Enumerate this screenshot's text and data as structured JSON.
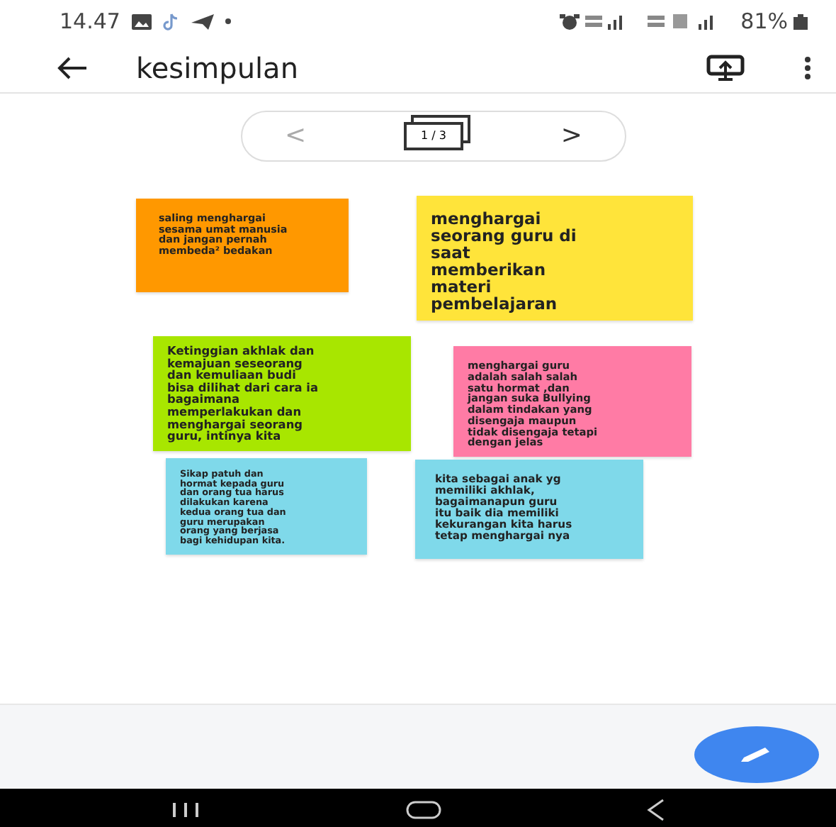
{
  "status_bar": {
    "time": "14.47",
    "battery": "81%"
  },
  "app_bar": {
    "title": "kesimpulan"
  },
  "pager": {
    "prev": "<",
    "page": "1 / 3",
    "next": ">"
  },
  "notes": [
    {
      "text": "saling menghargai\nsesama umat manusia\ndan jangan pernah\nmembeda² bedakan",
      "color": "#ff9800"
    },
    {
      "text": "menghargai\nseorang guru di\nsaat\nmemberikan\nmateri\npembelajaran",
      "color": "#ffe43a"
    },
    {
      "text": "Ketinggian akhlak dan\nkemajuan seseorang\ndan kemuliaan budi\nbisa dilihat dari cara ia\nbagaimana\nmemperlakukan dan\nmenghargai seorang\nguru, intinya kita",
      "color": "#a8e600"
    },
    {
      "text": "menghargai guru\nadalah salah salah\nsatu hormat ,dan\njangan suka Bullying\ndalam tindakan yang\ndisengaja maupun\ntidak disengaja tetapi\ndengan jelas",
      "color": "#ff7ba5"
    },
    {
      "text": "Sikap patuh dan\nhormat kepada guru\ndan orang tua harus\ndilakukan karena\nkedua orang tua dan\nguru merupakan\norang yang berjasa\nbagi kehidupan kita.",
      "color": "#7fd9ea"
    },
    {
      "text": "kita sebagai anak yg\nmemiliki akhlak,\nbagaimanapun guru\nitu baik dia memiliki\nkekurangan kita harus\ntetap menghargai nya",
      "color": "#7fd9ea"
    }
  ]
}
